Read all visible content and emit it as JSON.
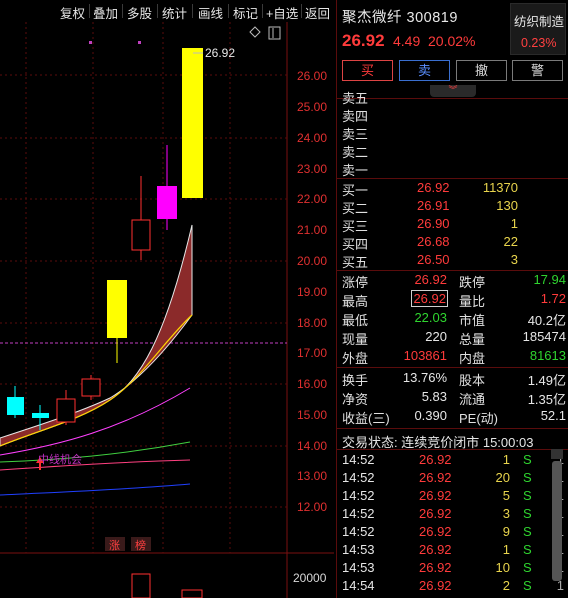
{
  "toolbar": {
    "items": [
      "复权",
      "叠加",
      "多股",
      "统计",
      "画线",
      "标记",
      "+自选",
      "返回"
    ]
  },
  "chart": {
    "y_ticks": [
      "26.00",
      "25.00",
      "24.00",
      "23.00",
      "22.00",
      "21.00",
      "20.00",
      "19.00",
      "18.00",
      "17.00",
      "16.00",
      "15.00",
      "14.00",
      "13.00",
      "12.00"
    ],
    "high_label": "26.92",
    "ma_label": "中线机会",
    "badges": [
      "涨",
      "榜"
    ],
    "volume_tick": "20000",
    "colors": {
      "up": "#ff3030",
      "limit_up": "#ffff00",
      "magenta": "#ff00ff",
      "cyan": "#00ffff",
      "band_fill": "#8b2a2a"
    }
  },
  "stock": {
    "name": "聚杰微纤",
    "code": "300819",
    "price": "26.92",
    "change": "4.49",
    "change_pct": "20.02%",
    "sector_name": "纺织制造",
    "sector_pct": "0.23%"
  },
  "trade_buttons": [
    "买",
    "卖",
    "撤",
    "警"
  ],
  "order_book": {
    "asks": [
      {
        "label": "卖五",
        "price": "",
        "vol": ""
      },
      {
        "label": "卖四",
        "price": "",
        "vol": ""
      },
      {
        "label": "卖三",
        "price": "",
        "vol": ""
      },
      {
        "label": "卖二",
        "price": "",
        "vol": ""
      },
      {
        "label": "卖一",
        "price": "",
        "vol": ""
      }
    ],
    "bids": [
      {
        "label": "买一",
        "price": "26.92",
        "vol": "11370"
      },
      {
        "label": "买二",
        "price": "26.91",
        "vol": "130"
      },
      {
        "label": "买三",
        "price": "26.90",
        "vol": "1"
      },
      {
        "label": "买四",
        "price": "26.68",
        "vol": "22"
      },
      {
        "label": "买五",
        "price": "26.50",
        "vol": "3"
      }
    ]
  },
  "stats": [
    {
      "k1": "涨停",
      "v1": "26.92",
      "c1": "red",
      "k2": "跌停",
      "v2": "17.94",
      "c2": "green"
    },
    {
      "k1": "最高",
      "v1": "26.92",
      "c1": "red",
      "k2": "量比",
      "v2": "1.72",
      "c2": "red"
    },
    {
      "k1": "最低",
      "v1": "22.03",
      "c1": "green",
      "k2": "市值",
      "v2": "40.2亿",
      "c2": "white"
    },
    {
      "k1": "现量",
      "v1": "220",
      "c1": "white",
      "k2": "总量",
      "v2": "185474",
      "c2": "white"
    },
    {
      "k1": "外盘",
      "v1": "103861",
      "c1": "red",
      "k2": "内盘",
      "v2": "81613",
      "c2": "green"
    },
    {
      "k1": "换手",
      "v1": "13.76%",
      "c1": "white",
      "k2": "股本",
      "v2": "1.49亿",
      "c2": "white"
    },
    {
      "k1": "净资",
      "v1": "5.83",
      "c1": "white",
      "k2": "流通",
      "v2": "1.35亿",
      "c2": "white"
    },
    {
      "k1": "收益(三)",
      "v1": "0.390",
      "c1": "white",
      "k2": "PE(动)",
      "v2": "52.1",
      "c2": "white"
    }
  ],
  "trade_status": "交易状态: 连续竞价闭市 15:00:03",
  "ticks": [
    {
      "time": "14:52",
      "price": "26.92",
      "vol": "1",
      "side": "S",
      "n": "1"
    },
    {
      "time": "14:52",
      "price": "26.92",
      "vol": "20",
      "side": "S",
      "n": "1"
    },
    {
      "time": "14:52",
      "price": "26.92",
      "vol": "5",
      "side": "S",
      "n": "1"
    },
    {
      "time": "14:52",
      "price": "26.92",
      "vol": "3",
      "side": "S",
      "n": "1"
    },
    {
      "time": "14:52",
      "price": "26.92",
      "vol": "9",
      "side": "S",
      "n": "1"
    },
    {
      "time": "14:53",
      "price": "26.92",
      "vol": "1",
      "side": "S",
      "n": "1"
    },
    {
      "time": "14:53",
      "price": "26.92",
      "vol": "10",
      "side": "S",
      "n": "1"
    },
    {
      "time": "14:54",
      "price": "26.92",
      "vol": "2",
      "side": "S",
      "n": "1"
    }
  ]
}
